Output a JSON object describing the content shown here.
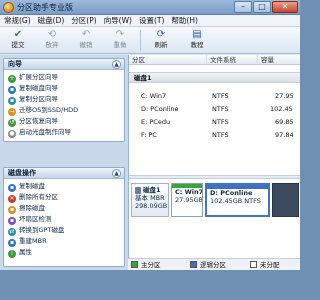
{
  "window": {
    "title": "分区助手专业版",
    "min_glyph": "–",
    "max_glyph": "□",
    "close_glyph": "✕"
  },
  "menu": [
    "常规(G)",
    "磁盘(D)",
    "分区(P)",
    "向导(W)",
    "设置(T)",
    "帮助(H)"
  ],
  "toolbar": {
    "submit": "提交",
    "discard": "放弃",
    "undo": "撤销",
    "redo": "重做",
    "refresh": "刷新",
    "tutorial": "教程"
  },
  "wizard": {
    "heading": "向导",
    "items": [
      "扩展分区向导",
      "复制磁盘向导",
      "复制分区向导",
      "迁移OS到SSD/HDD",
      "分区恢复向导",
      "启动光盘制作向导"
    ]
  },
  "disk_ops": {
    "heading": "磁盘操作",
    "items": [
      "复制磁盘",
      "删除所有分区",
      "擦除磁盘",
      "坏扇区检测",
      "转换到GPT磁盘",
      "重建MBR",
      "属性"
    ]
  },
  "table": {
    "headers": [
      "分区",
      "文件系统",
      "容量"
    ],
    "disk_label": "磁盘1",
    "rows": [
      {
        "name": "C: Win7",
        "fs": "NTFS",
        "cap": "27.95"
      },
      {
        "name": "D: PConline",
        "fs": "NTFS",
        "cap": "102.45"
      },
      {
        "name": "E: PCedu",
        "fs": "NTFS",
        "cap": "69.85"
      },
      {
        "name": "F: PC",
        "fs": "NTFS",
        "cap": "97.84"
      }
    ]
  },
  "diskmap": {
    "disk_name": "磁盘1",
    "disk_type": "基本 MBR",
    "disk_size": "298.09GB",
    "partitions": [
      {
        "name": "C: Win7",
        "size": "27.95GB",
        "color": "#3aa43a"
      },
      {
        "name": "D: PConline",
        "size": "102.45GB NTFS",
        "color": "#3e6fc4"
      }
    ]
  },
  "legend": [
    {
      "label": "主分区",
      "color": "#3aa43a"
    },
    {
      "label": "逻辑分区",
      "color": "#3e6fc4"
    },
    {
      "label": "未分配",
      "color": "#ffffff"
    }
  ]
}
